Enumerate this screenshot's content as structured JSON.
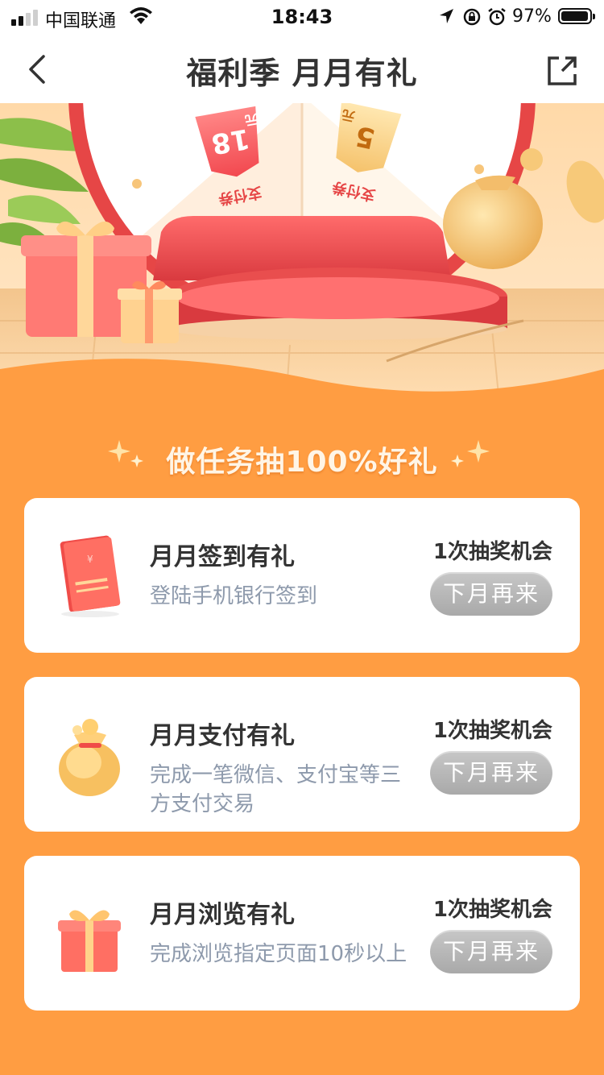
{
  "status_bar": {
    "carrier": "中国联通",
    "time": "18:43",
    "battery_percent": "97%",
    "battery_level": 0.97,
    "icons": [
      "signal-icon",
      "wifi-icon",
      "location-arrow-icon",
      "rotation-lock-icon",
      "alarm-icon",
      "battery-icon"
    ]
  },
  "nav": {
    "title": "福利季 月月有礼",
    "back_icon": "chevron-left-icon",
    "share_icon": "share-external-icon"
  },
  "banner": {
    "prize_left": {
      "amount": "18",
      "unit": "元",
      "label": "支付券"
    },
    "prize_right": {
      "amount": "5",
      "unit": "元",
      "label": "支付券"
    }
  },
  "section": {
    "heading": "做任务抽100%好礼"
  },
  "tasks": [
    {
      "icon": "red-notebook-icon",
      "title": "月月签到有礼",
      "description": "登陆手机银行签到",
      "chance": "1次抽奖机会",
      "button": "下月再来"
    },
    {
      "icon": "money-bag-icon",
      "title": "月月支付有礼",
      "description": "完成一笔微信、支付宝等三方支付交易",
      "chance": "1次抽奖机会",
      "button": "下月再来"
    },
    {
      "icon": "gift-box-icon",
      "title": "月月浏览有礼",
      "description": "完成浏览指定页面10秒以上",
      "chance": "1次抽奖机会",
      "button": "下月再来"
    }
  ],
  "colors": {
    "page_background": "#ff9d42",
    "disabled_button": "#b5b5b5",
    "title_text": "#333333",
    "desc_text": "#8e9aac"
  }
}
